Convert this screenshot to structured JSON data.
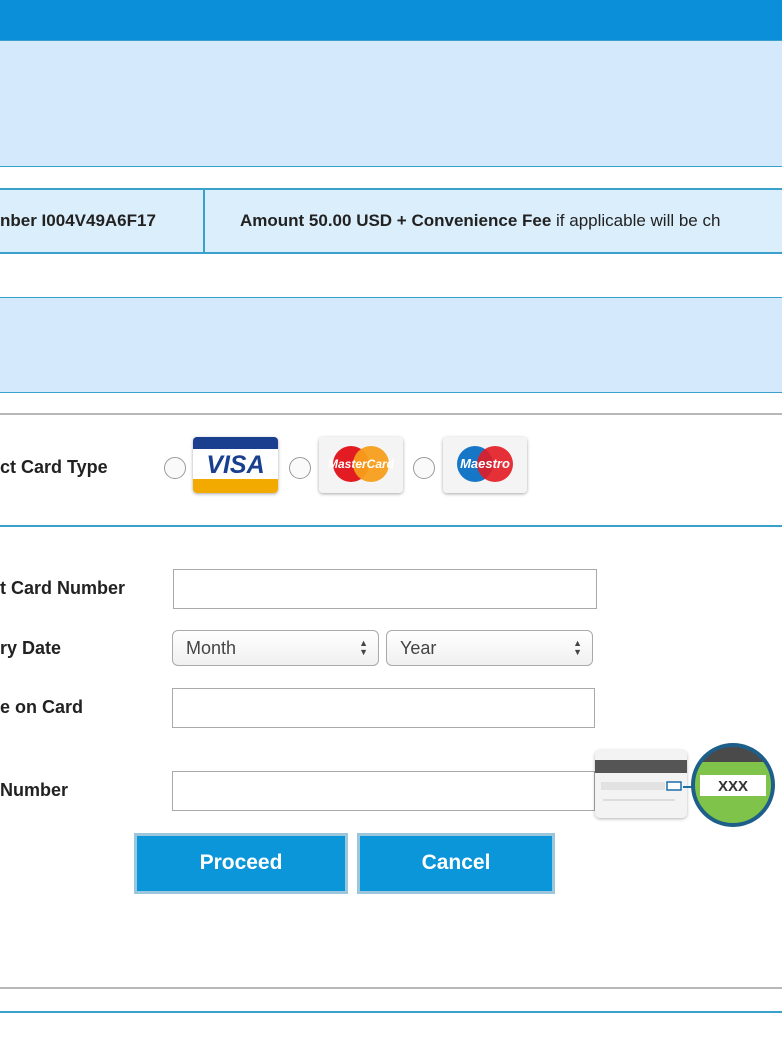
{
  "info": {
    "reference_text": "nber I004V49A6F17",
    "amount_bold": "Amount 50.00 USD + Convenience Fee",
    "amount_rest": " if applicable will be ch"
  },
  "card_type": {
    "label": "ct Card Type",
    "options": [
      {
        "name": "VISA",
        "brand": "VISA"
      },
      {
        "name": "MasterCard",
        "brand": "MasterCard"
      },
      {
        "name": "Maestro",
        "brand": "Maestro"
      }
    ]
  },
  "form": {
    "card_number_label": "t Card Number",
    "card_number_value": "",
    "expiry_label": "ry Date",
    "month_value": "Month",
    "year_value": "Year",
    "name_label": "e on Card",
    "name_value": "",
    "cvv_label": " Number",
    "cvv_value": "",
    "cvv_hint": "XXX"
  },
  "buttons": {
    "proceed": "Proceed",
    "cancel": "Cancel"
  },
  "colors": {
    "topbar": "#0a8fd8",
    "panel": "#d4eafc",
    "border": "#3aa0cc",
    "button": "#0a96d8"
  }
}
